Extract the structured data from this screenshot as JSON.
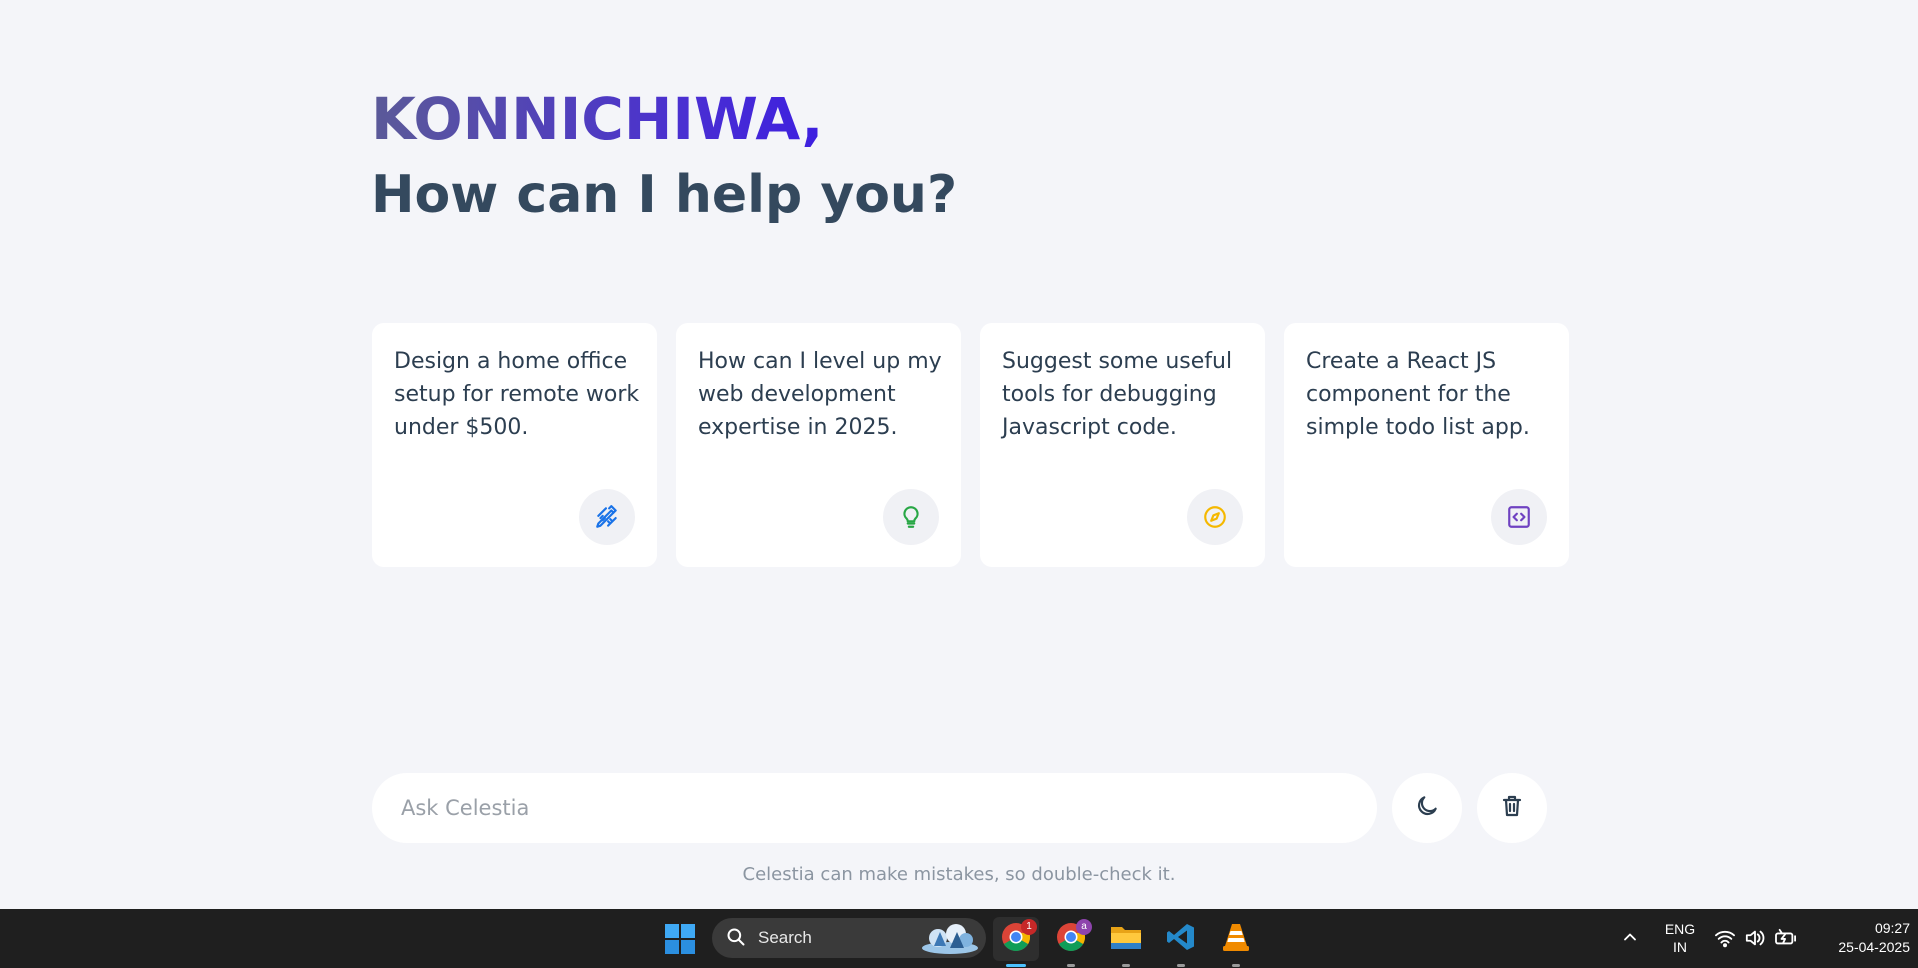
{
  "header": {
    "greeting": "KONNICHIWA,",
    "subtitle": "How can I help you?"
  },
  "suggestions": [
    {
      "text": "Design a home office setup for remote work under $500.",
      "icon": "pen-ruler-icon",
      "icon_color": "#1a73e8"
    },
    {
      "text": "How can I level up my web development expertise in 2025.",
      "icon": "lightbulb-icon",
      "icon_color": "#28a745"
    },
    {
      "text": "Suggest some useful tools for debugging Javascript code.",
      "icon": "compass-icon",
      "icon_color": "#f5b800"
    },
    {
      "text": "Create a React JS component for the simple todo list app.",
      "icon": "code-icon",
      "icon_color": "#6f42c1"
    }
  ],
  "prompt": {
    "placeholder": "Ask Celestia",
    "value": "",
    "theme_toggle_icon": "moon-icon",
    "delete_icon": "trash-icon"
  },
  "disclaimer": "Celestia can make mistakes, so double-check it.",
  "taskbar": {
    "search_label": "Search",
    "apps": [
      {
        "name": "chrome",
        "badge": "1",
        "active": true
      },
      {
        "name": "chrome-profile",
        "badge": "a",
        "active": false
      },
      {
        "name": "file-explorer",
        "active": false
      },
      {
        "name": "vs-code",
        "active": false
      },
      {
        "name": "vlc",
        "active": false
      }
    ],
    "language_line1": "ENG",
    "language_line2": "IN",
    "time": "09:27",
    "date": "25-04-2025"
  }
}
